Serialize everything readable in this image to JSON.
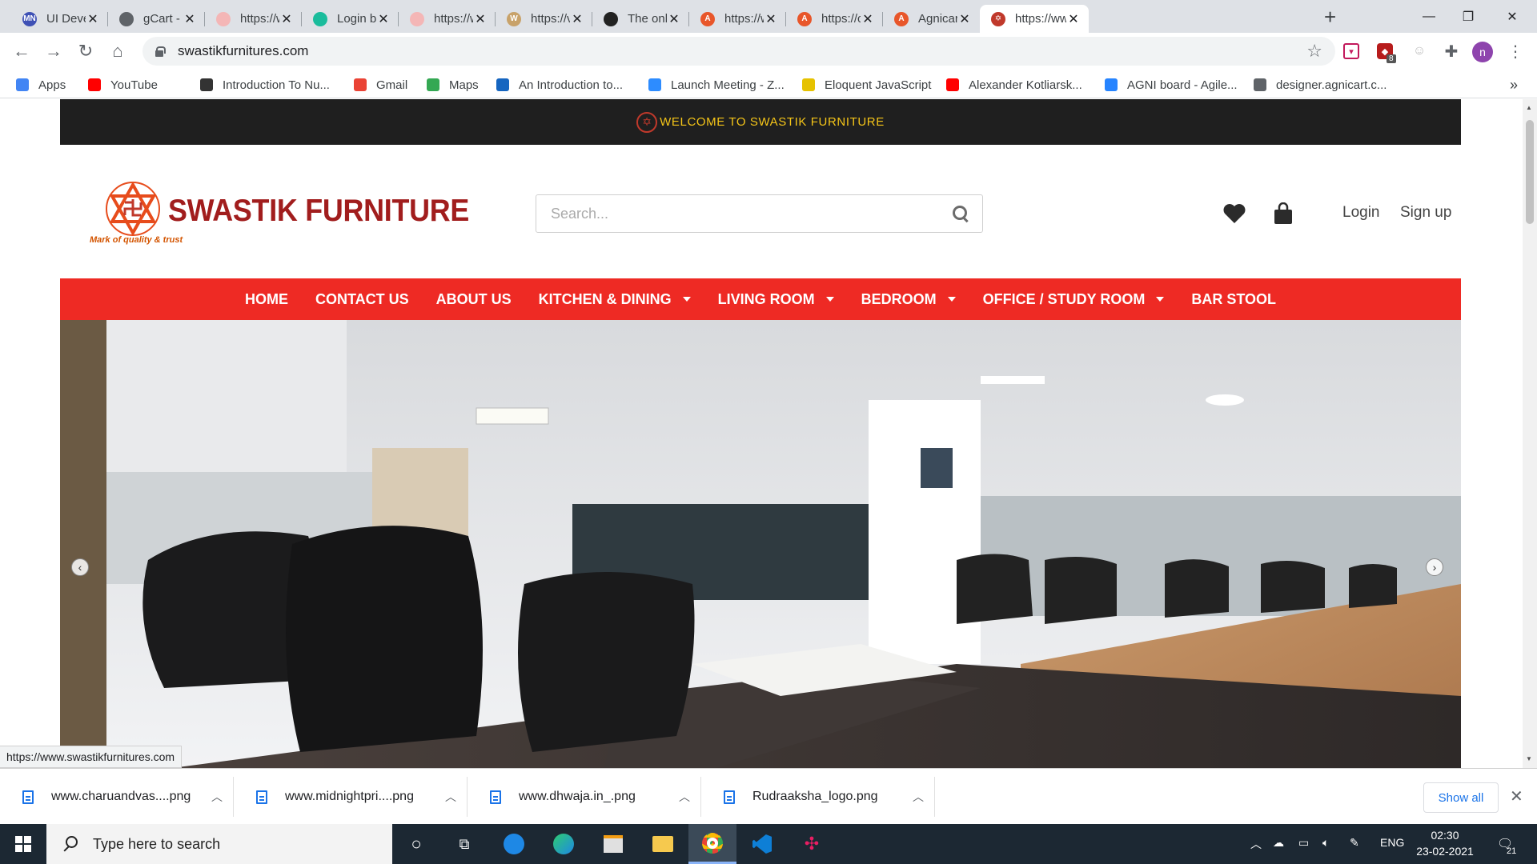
{
  "browser": {
    "tabs": [
      {
        "title": "UI Develop",
        "fav_color": "#3f51b5",
        "fav_text": "MN"
      },
      {
        "title": "gCart - An",
        "fav_color": "#5f6368",
        "fav_text": ""
      },
      {
        "title": "https://ww",
        "fav_color": "#f4b6b6",
        "fav_text": ""
      },
      {
        "title": "Login by C",
        "fav_color": "#1abc9c",
        "fav_text": ""
      },
      {
        "title": "https://ww",
        "fav_color": "#f4b6b6",
        "fav_text": ""
      },
      {
        "title": "https://vec",
        "fav_color": "#c8a26a",
        "fav_text": "W"
      },
      {
        "title": "The online",
        "fav_color": "#222222",
        "fav_text": ""
      },
      {
        "title": "https://ww",
        "fav_color": "#e8562a",
        "fav_text": "A"
      },
      {
        "title": "https://cla",
        "fav_color": "#e8562a",
        "fav_text": "A"
      },
      {
        "title": "Agnicart e",
        "fav_color": "#e8562a",
        "fav_text": "A"
      },
      {
        "title": "https://ww",
        "fav_color": "#c0392b",
        "fav_text": "✡"
      }
    ],
    "active_tab_index": 10,
    "new_tab_symbol": "+",
    "url": "swastikfurnitures.com",
    "extension_badge": "8",
    "profile_initial": "n",
    "bookmarks": [
      {
        "label": "Apps",
        "icon": "apps-grid-icon",
        "color": "#4285f4"
      },
      {
        "label": "YouTube",
        "icon": "youtube-icon",
        "color": "#ff0000"
      },
      {
        "label": "Introduction To Nu...",
        "icon": "bookmark-icon",
        "color": "#333333"
      },
      {
        "label": "Gmail",
        "icon": "gmail-icon",
        "color": "#ea4335"
      },
      {
        "label": "Maps",
        "icon": "maps-icon",
        "color": "#34a853"
      },
      {
        "label": "An Introduction to...",
        "icon": "bookmark-icon",
        "color": "#1565c0"
      },
      {
        "label": "Launch Meeting - Z...",
        "icon": "zoom-icon",
        "color": "#2d8cff"
      },
      {
        "label": "Eloquent JavaScript",
        "icon": "ejs-icon",
        "color": "#e6c200"
      },
      {
        "label": "Alexander Kotliarsk...",
        "icon": "youtube-icon",
        "color": "#ff0000"
      },
      {
        "label": "AGNI board - Agile...",
        "icon": "jira-icon",
        "color": "#2684ff"
      },
      {
        "label": "designer.agnicart.c...",
        "icon": "globe-icon",
        "color": "#5f6368"
      }
    ],
    "bookmarks_overflow": "»",
    "status_url": "https://www.swastikfurnitures.com"
  },
  "site": {
    "welcome": "WELCOME TO SWASTIK FURNITURE",
    "brand_name": "SWASTIK FURNITURE",
    "tagline": "Mark of quality & trust",
    "search_placeholder": "Search...",
    "login": "Login",
    "signup": "Sign up",
    "colors": {
      "topbar": "#1f1f1f",
      "welcome_text": "#f5c518",
      "menu": "#ee2a24",
      "brand": "#a11d1d"
    },
    "menu": [
      {
        "label": "HOME",
        "dropdown": false
      },
      {
        "label": "CONTACT US",
        "dropdown": false
      },
      {
        "label": "ABOUT US",
        "dropdown": false
      },
      {
        "label": "KITCHEN & DINING",
        "dropdown": true
      },
      {
        "label": "LIVING ROOM",
        "dropdown": true
      },
      {
        "label": "BEDROOM",
        "dropdown": true
      },
      {
        "label": "OFFICE / STUDY ROOM",
        "dropdown": true
      },
      {
        "label": "BAR STOOL",
        "dropdown": false
      }
    ],
    "slider": {
      "prev": "‹",
      "next": "›"
    }
  },
  "downloads": {
    "items": [
      "www.charuandvas....png",
      "www.midnightpri....png",
      "www.dhwaja.in_.png",
      "Rudraaksha_logo.png"
    ],
    "show_all": "Show all"
  },
  "taskbar": {
    "search_placeholder": "Type here to search",
    "language": "ENG",
    "time": "02:30",
    "date": "23-02-2021",
    "notifications": "21"
  }
}
